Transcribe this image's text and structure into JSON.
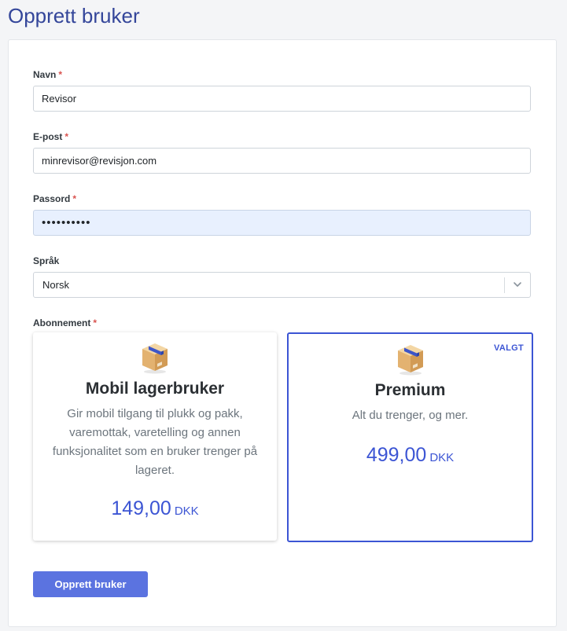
{
  "page": {
    "title": "Opprett bruker"
  },
  "form": {
    "name": {
      "label": "Navn",
      "required": "*",
      "value": "Revisor"
    },
    "email": {
      "label": "E-post",
      "required": "*",
      "value": "minrevisor@revisjon.com"
    },
    "password": {
      "label": "Passord",
      "required": "*",
      "value": "••••••••••"
    },
    "language": {
      "label": "Språk",
      "value": "Norsk"
    },
    "subscription": {
      "label": "Abonnement",
      "required": "*",
      "plans": [
        {
          "icon": "package-box-icon",
          "name": "Mobil lagerbruker",
          "description": "Gir mobil tilgang til plukk og pakk, varemottak, varetelling og annen funksjonalitet som en bruker trenger på lageret.",
          "price": "149,00",
          "currency": "DKK"
        },
        {
          "icon": "package-box-icon",
          "name": "Premium",
          "description": "Alt du trenger, og mer.",
          "price": "499,00",
          "currency": "DKK",
          "selected_label": "VALGT"
        }
      ]
    },
    "submit_label": "Opprett bruker"
  },
  "colors": {
    "title": "#34469a",
    "accent": "#3c55d4",
    "button": "#5b73e0",
    "required": "#d9534f",
    "autofill": "#e8f0fe"
  }
}
